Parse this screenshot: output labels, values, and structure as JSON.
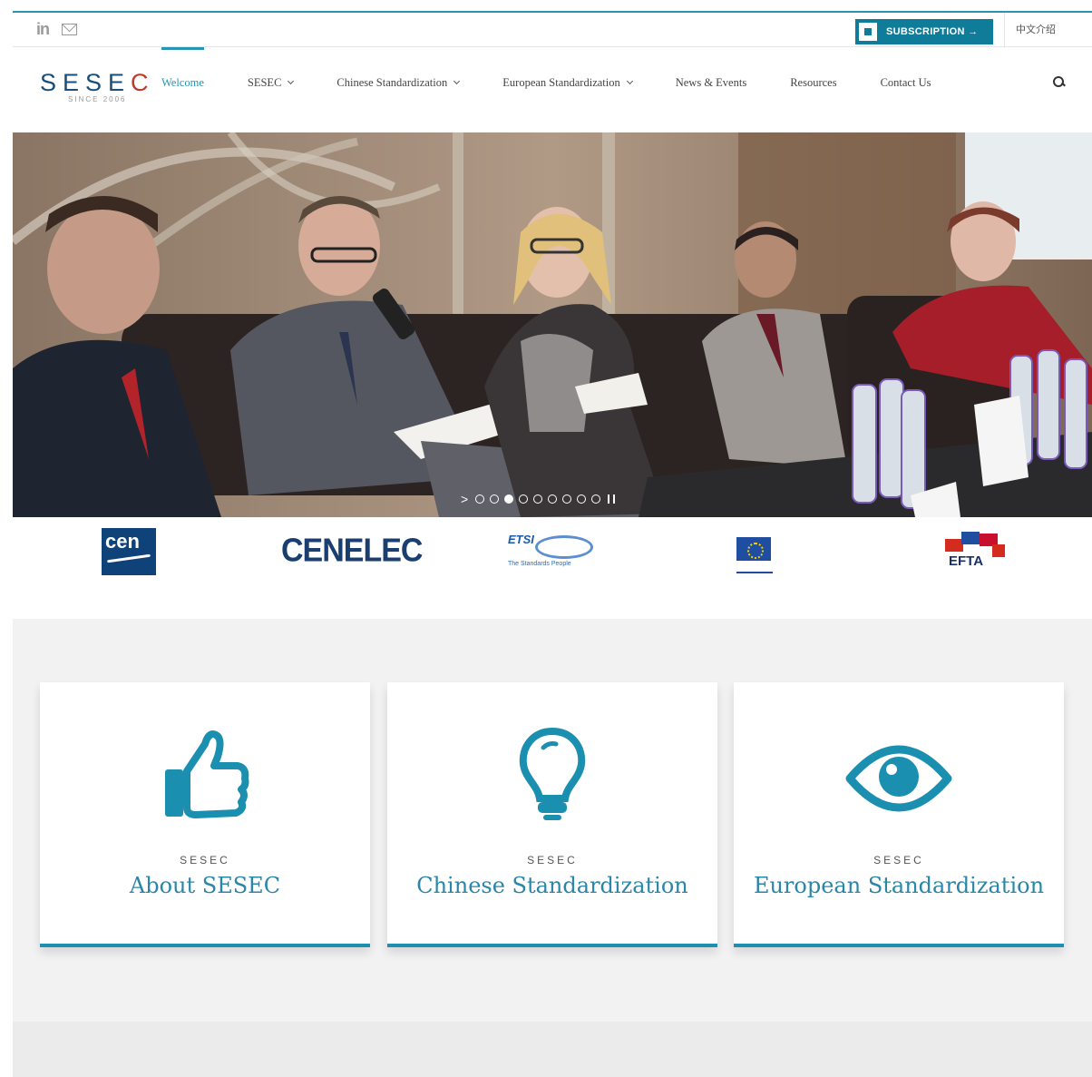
{
  "topbar": {
    "social": [
      {
        "icon": "linkedin-icon",
        "label": "in"
      },
      {
        "icon": "mail-icon"
      }
    ],
    "subscribe_label": "SUBSCRIPTION →",
    "language_label": "中文介绍"
  },
  "logo": {
    "word": "SESEC",
    "since": "SINCE 2006"
  },
  "nav": {
    "items": [
      {
        "label": "Welcome",
        "active": true,
        "dropdown": false
      },
      {
        "label": "SESEC",
        "active": false,
        "dropdown": true
      },
      {
        "label": "Chinese Standardization",
        "active": false,
        "dropdown": true
      },
      {
        "label": "European Standardization",
        "active": false,
        "dropdown": true
      },
      {
        "label": "News & Events",
        "active": false,
        "dropdown": false
      },
      {
        "label": "Resources",
        "active": false,
        "dropdown": false
      },
      {
        "label": "Contact Us",
        "active": false,
        "dropdown": false
      }
    ],
    "search_icon": "search-icon"
  },
  "slider": {
    "slide_count": 10,
    "active_index": 3,
    "next_arrow": ">"
  },
  "partners": [
    {
      "name": "cen",
      "text": "cen"
    },
    {
      "name": "cenelec",
      "text": "CENELEC"
    },
    {
      "name": "etsi",
      "text": "ETSI",
      "tagline": "The Standards People"
    },
    {
      "name": "european-commission"
    },
    {
      "name": "efta",
      "text": "EFTA"
    }
  ],
  "cards": [
    {
      "icon": "thumbs-up-icon",
      "kicker": "SESEC",
      "title": "About SESEC"
    },
    {
      "icon": "lightbulb-icon",
      "kicker": "SESEC",
      "title": "Chinese Standardization"
    },
    {
      "icon": "eye-icon",
      "kicker": "SESEC",
      "title": "European Standardization"
    }
  ],
  "colors": {
    "accent": "#2a95b3",
    "button": "#0f7c99",
    "card_title": "#2a86a8"
  }
}
